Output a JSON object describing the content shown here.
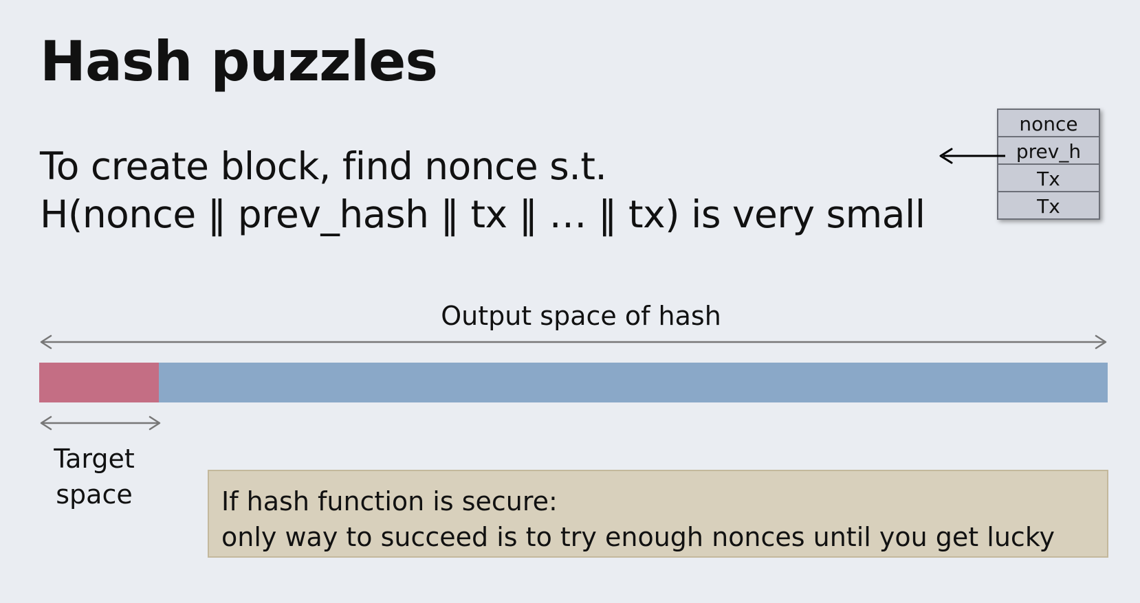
{
  "title": "Hash puzzles",
  "statement": {
    "line1": "To create block, find nonce s.t.",
    "line2": "H(nonce ‖ prev_hash ‖ tx ‖ … ‖ tx) is very small"
  },
  "block": {
    "fields": [
      "nonce",
      "prev_h",
      "Tx",
      "Tx"
    ]
  },
  "hash_space": {
    "output_label": "Output space of hash",
    "target_label_line1": "Target",
    "target_label_line2": "space",
    "target_fraction": 0.112
  },
  "callout": {
    "line1": "If hash function is secure:",
    "line2": "only way to succeed is to try enough nonces until you get lucky"
  },
  "colors": {
    "background": "#eaedf2",
    "target": "#c46e84",
    "output_space": "#8aa8c8",
    "callout_bg": "#d8d0bc",
    "block_cell": "#c9ccd6"
  }
}
